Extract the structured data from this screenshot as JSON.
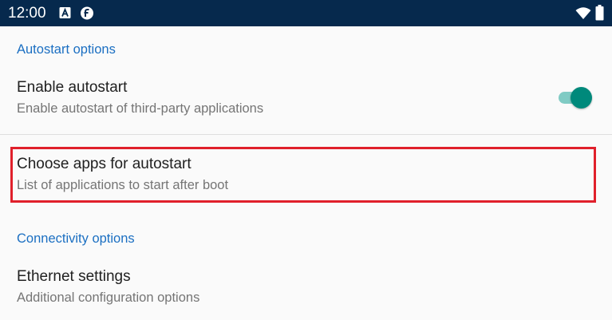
{
  "status_bar": {
    "time": "12:00",
    "icons": [
      "a-notification-icon",
      "f-notification-icon",
      "wifi-icon",
      "battery-icon"
    ],
    "background": "#06294d"
  },
  "sections": [
    {
      "header": "Autostart options",
      "items": [
        {
          "title": "Enable autostart",
          "summary": "Enable autostart of third-party applications",
          "switch": {
            "checked": true,
            "icon": "toggle-switch"
          }
        },
        {
          "title": "Choose apps for autostart",
          "summary": "List of applications to start after boot",
          "highlighted": true
        }
      ]
    },
    {
      "header": "Connectivity options",
      "items": [
        {
          "title": "Ethernet settings",
          "summary": "Additional configuration options"
        }
      ]
    }
  ],
  "colors": {
    "accent": "#1b6fc2",
    "switch_thumb": "#00897b",
    "switch_track": "#80cbc4",
    "highlight": "#e0202b",
    "background": "#fafafa"
  }
}
